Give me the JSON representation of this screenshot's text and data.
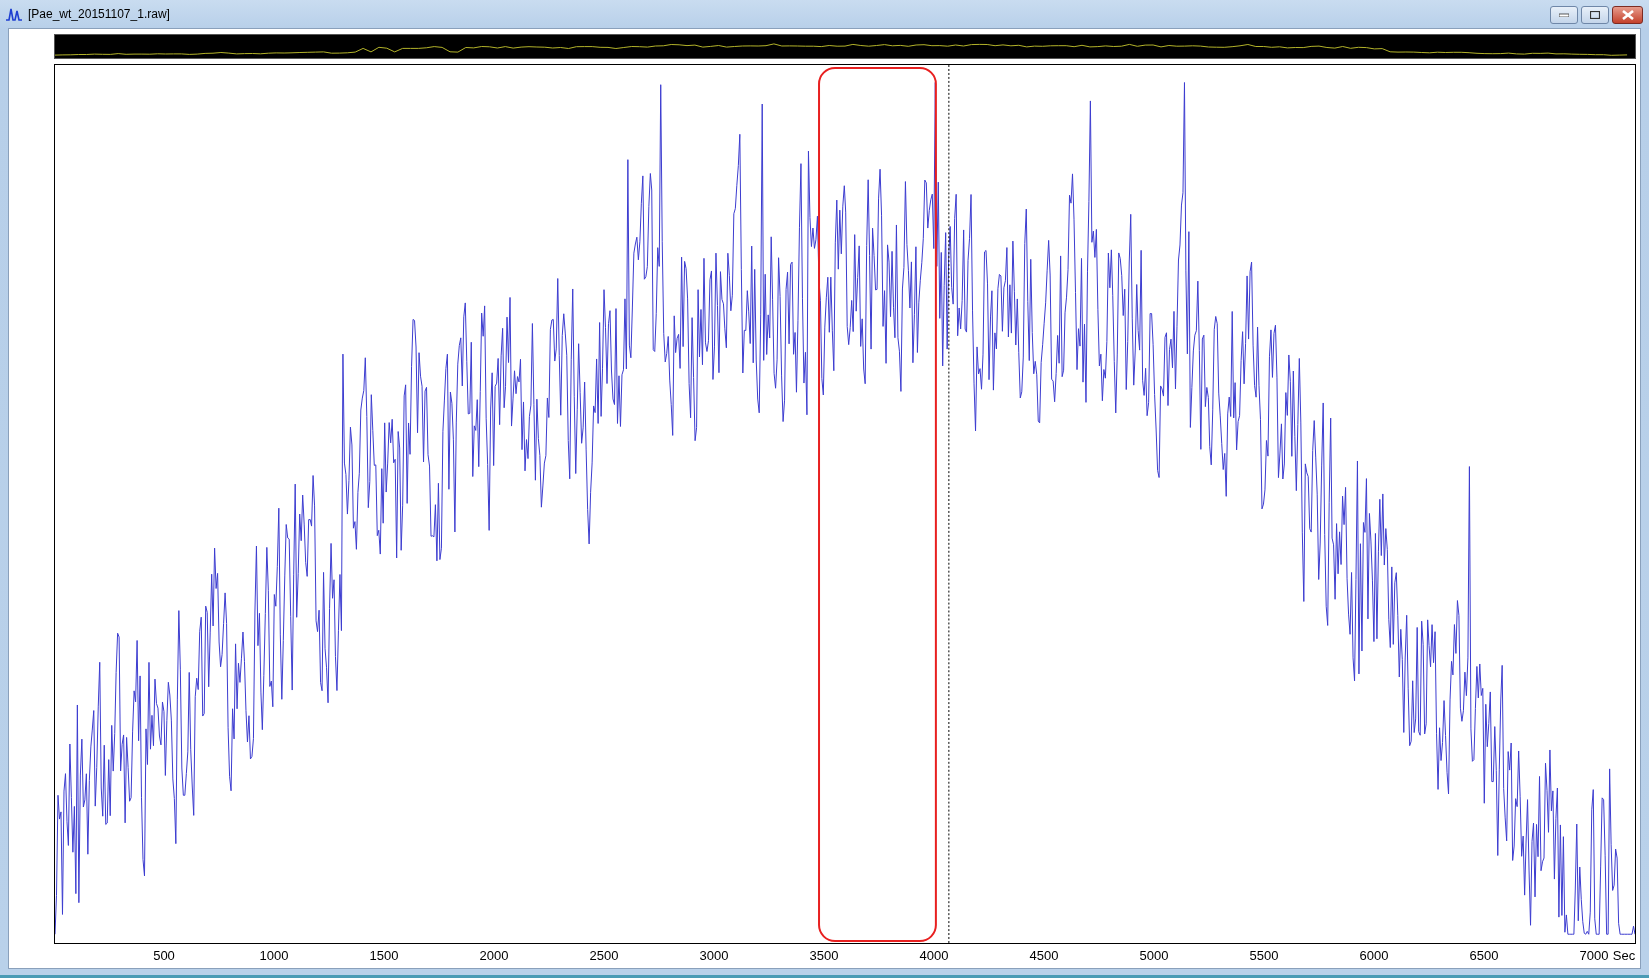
{
  "window": {
    "title": "[Pae_wt_20151107_1.raw]"
  },
  "chart": {
    "x_ticks": [
      "500",
      "1000",
      "1500",
      "2000",
      "2500",
      "3000",
      "3500",
      "4000",
      "4500",
      "5000",
      "5500",
      "6000",
      "6500",
      "7000"
    ],
    "x_unit": "Sec"
  }
}
